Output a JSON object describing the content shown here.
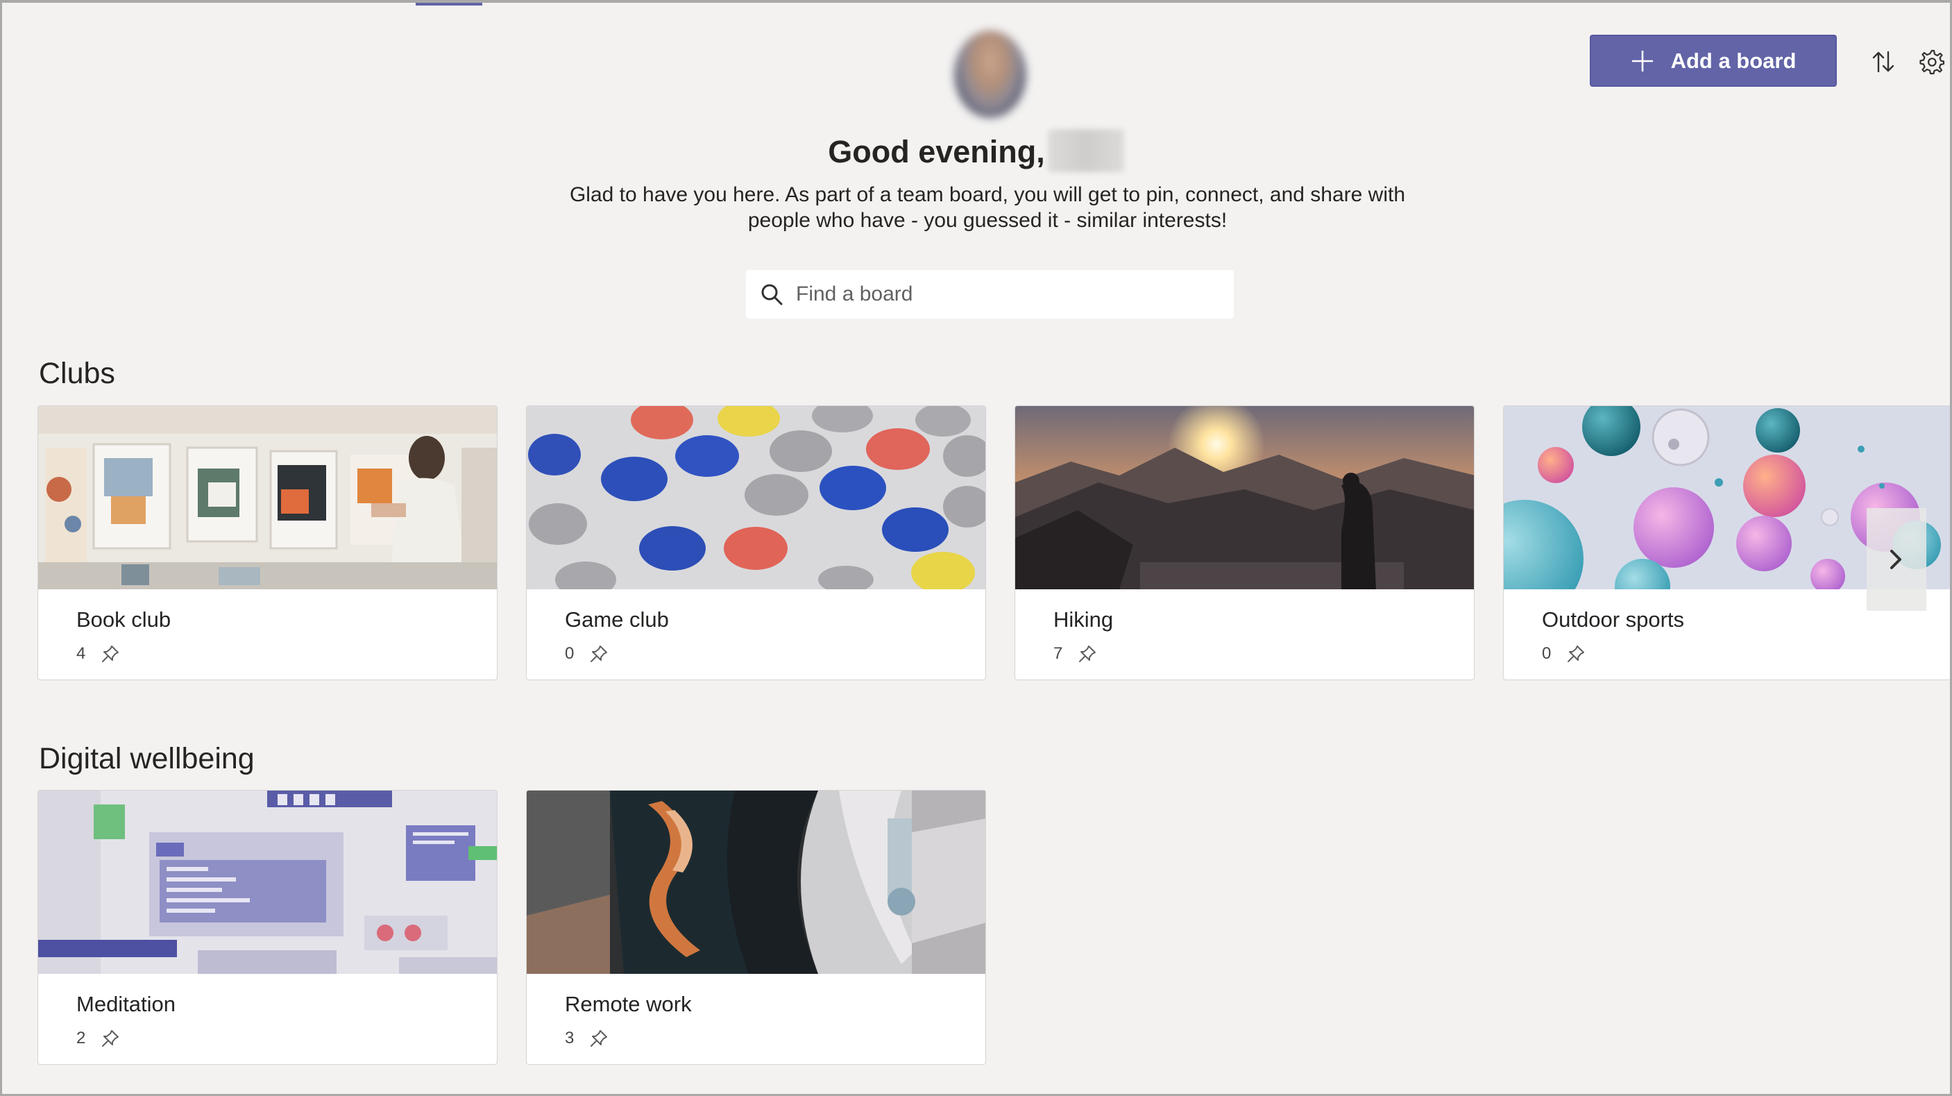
{
  "header": {
    "greeting": "Good evening,",
    "subtitle": "Glad to have you here. As part of a team board, you will get to pin, connect, and share with people who have - you guessed it - similar interests!",
    "search_placeholder": "Find a board",
    "add_board_label": "Add a board"
  },
  "sections": [
    {
      "title": "Clubs",
      "boards": [
        {
          "title": "Book club",
          "pins": "4"
        },
        {
          "title": "Game club",
          "pins": "0"
        },
        {
          "title": "Hiking",
          "pins": "7"
        },
        {
          "title": "Outdoor sports",
          "pins": "0"
        }
      ]
    },
    {
      "title": "Digital wellbeing",
      "boards": [
        {
          "title": "Meditation",
          "pins": "2"
        },
        {
          "title": "Remote work",
          "pins": "3"
        }
      ]
    }
  ],
  "icons": {
    "add": "plus-icon",
    "sort": "sort-icon",
    "settings": "gear-icon",
    "search": "search-icon",
    "pin": "pin-icon",
    "next": "chevron-right-icon"
  },
  "colors": {
    "accent": "#6264a7",
    "background": "#f3f2f1",
    "card": "#ffffff",
    "text": "#252423"
  }
}
